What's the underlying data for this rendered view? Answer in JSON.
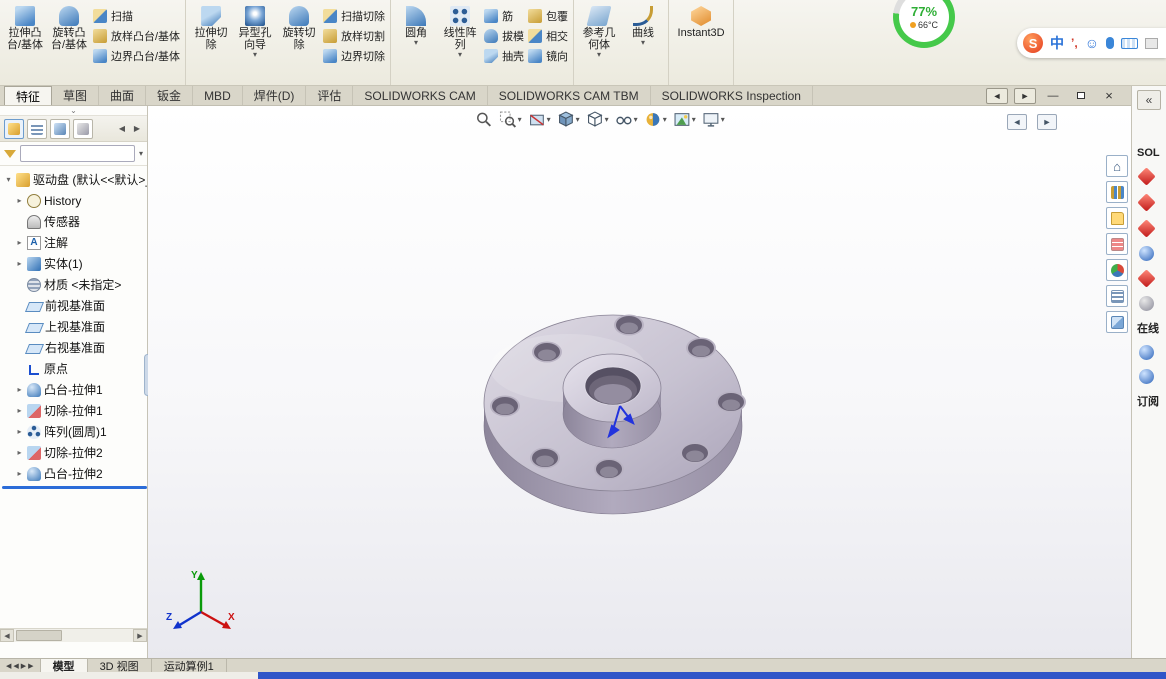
{
  "ribbon": {
    "extrude_boss": "拉伸凸台/基体",
    "revolve_boss": "旋转凸台/基体",
    "sweep": "扫描",
    "loft": "放样凸台/基体",
    "boundary": "边界凸台/基体",
    "extrude_cut": "拉伸切除",
    "hole_wizard": "异型孔向导",
    "revolve_cut": "旋转切除",
    "sweep_cut": "扫描切除",
    "loft_cut": "放样切割",
    "boundary_cut": "边界切除",
    "fillet": "圆角",
    "linear_pattern": "线性阵列",
    "rib": "筋",
    "draft": "拔模",
    "shell": "抽壳",
    "wrap": "包覆",
    "intersect": "相交",
    "mirror": "镜向",
    "ref_geometry": "参考几何体",
    "curves": "曲线",
    "instant3d": "Instant3D",
    "gauge_percent": "77%",
    "gauge_temp": "66°C"
  },
  "ime": {
    "logo": "S",
    "lang": "中",
    "punct": "’,",
    "smile": "☺"
  },
  "tabs": [
    "特征",
    "草图",
    "曲面",
    "钣金",
    "MBD",
    "焊件(D)",
    "评估",
    "SOLIDWORKS CAM",
    "SOLIDWORKS CAM TBM",
    "SOLIDWORKS Inspection"
  ],
  "tree": {
    "root": "驱动盘 (默认<<默认>_显",
    "items": [
      "History",
      "传感器",
      "注解",
      "实体(1)",
      "材质 <未指定>",
      "前视基准面",
      "上视基准面",
      "右视基准面",
      "原点",
      "凸台-拉伸1",
      "切除-拉伸1",
      "阵列(圆周)1",
      "切除-拉伸2",
      "凸台-拉伸2"
    ]
  },
  "taskpane": {
    "title_cut": "SOL",
    "online": "在线",
    "subscribe": "订阅"
  },
  "status": {
    "tabs": [
      "模型",
      "3D 视图",
      "运动算例1"
    ]
  },
  "triad": {
    "x": "X",
    "y": "Y",
    "z": "Z"
  }
}
